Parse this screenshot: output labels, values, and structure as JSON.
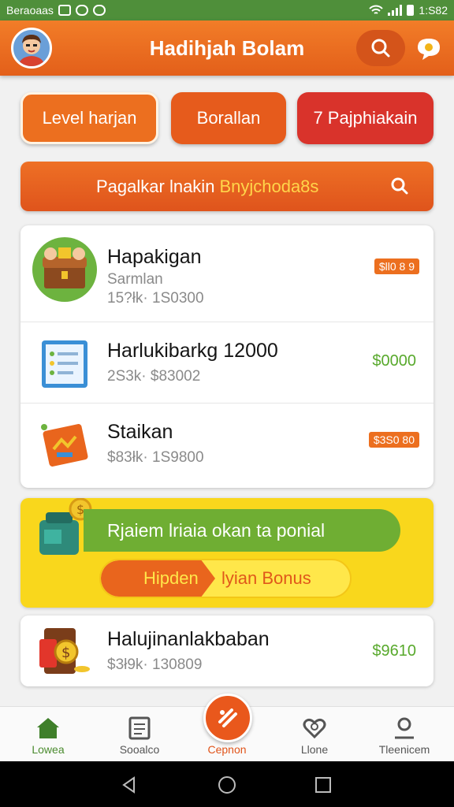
{
  "status_bar": {
    "left_text": "Beraoaas",
    "time": "1:S82"
  },
  "app_bar": {
    "title": "Hadihjah Bolam"
  },
  "pills": [
    {
      "label": "Level harjan"
    },
    {
      "label": "Borallan"
    },
    {
      "label": "7 Pajphiakain"
    }
  ],
  "search_banner": {
    "text": "Pagalkar lnakin",
    "highlight": "Bnyjchoda8s"
  },
  "list": [
    {
      "title": "Hapakigan",
      "subtitle_1": "Sarmlan",
      "subtitle_2": "15?łk· 1S0300",
      "price": "$ll0 8 9",
      "price_style": "badge"
    },
    {
      "title": "Harlukibarkg 12000",
      "subtitle_2": "2S3k· $83002",
      "price": "$0000",
      "price_style": "text"
    },
    {
      "title": "Staikan",
      "subtitle_2": "$83łk· 1S9800",
      "price": "$3S0 80",
      "price_style": "badge"
    }
  ],
  "bonus_banner": {
    "strip_text": "Rjaiem lriaia okan ta ponial",
    "pill_left": "Hipden",
    "pill_right": "lyian Bonus"
  },
  "last_item": {
    "title": "Halujinanlakbaban",
    "subtitle": "$3ł9k· 130809",
    "price": "$9610"
  },
  "bottom_nav": [
    {
      "label": "Lowea",
      "icon": "home-icon"
    },
    {
      "label": "Sooalco",
      "icon": "document-icon"
    },
    {
      "label": "Cepnon",
      "icon": "coupon-icon"
    },
    {
      "label": "Llone",
      "icon": "heart-search-icon"
    },
    {
      "label": "Tleenicem",
      "icon": "profile-icon"
    }
  ],
  "colors": {
    "primary": "#ec6f1f",
    "accent_green": "#58a92c",
    "banner_yellow": "#f9d71c",
    "danger_red": "#d9332b"
  }
}
